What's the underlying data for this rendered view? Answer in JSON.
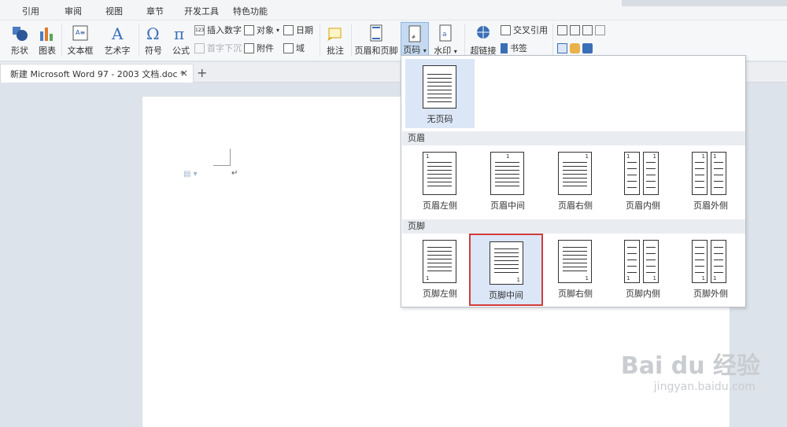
{
  "menu": {
    "items": [
      "引用",
      "审阅",
      "视图",
      "章节",
      "开发工具",
      "特色功能"
    ]
  },
  "ribbon": {
    "shapes_label": "形状",
    "chart_label": "图表",
    "textbox_label": "文本框",
    "wordart_label": "艺术字",
    "symbol_label": "符号",
    "formula_label": "公式",
    "insert_number": "插入数字",
    "object": "对象",
    "date": "日期",
    "dropcap": "首字下沉",
    "attachment": "附件",
    "field": "域",
    "comment_label": "批注",
    "header_footer_label": "页眉和页脚",
    "page_number_label": "页码",
    "watermark_label": "水印",
    "hyperlink_label": "超链接",
    "crossref": "交叉引用",
    "bookmark": "书签"
  },
  "tabs": {
    "document": "新建 Microsoft Word 97 - 2003 文档.doc *",
    "close": "×",
    "new": "+"
  },
  "dropdown": {
    "none_label": "无页码",
    "header_title": "页眉",
    "footer_title": "页脚",
    "header_items": [
      "页眉左侧",
      "页眉中间",
      "页眉右侧",
      "页眉内侧",
      "页眉外侧"
    ],
    "footer_items": [
      "页脚左侧",
      "页脚中间",
      "页脚右侧",
      "页脚内侧",
      "页脚外侧"
    ],
    "page_digit": "1"
  },
  "document": {
    "para_mark": "↵"
  },
  "watermark": {
    "brand": "Bai du 经验",
    "url": "jingyan.baidu.com"
  },
  "colors": {
    "accent": "#2b579a",
    "highlight": "#d23c3c",
    "selected_bg": "#dbe6f6"
  }
}
